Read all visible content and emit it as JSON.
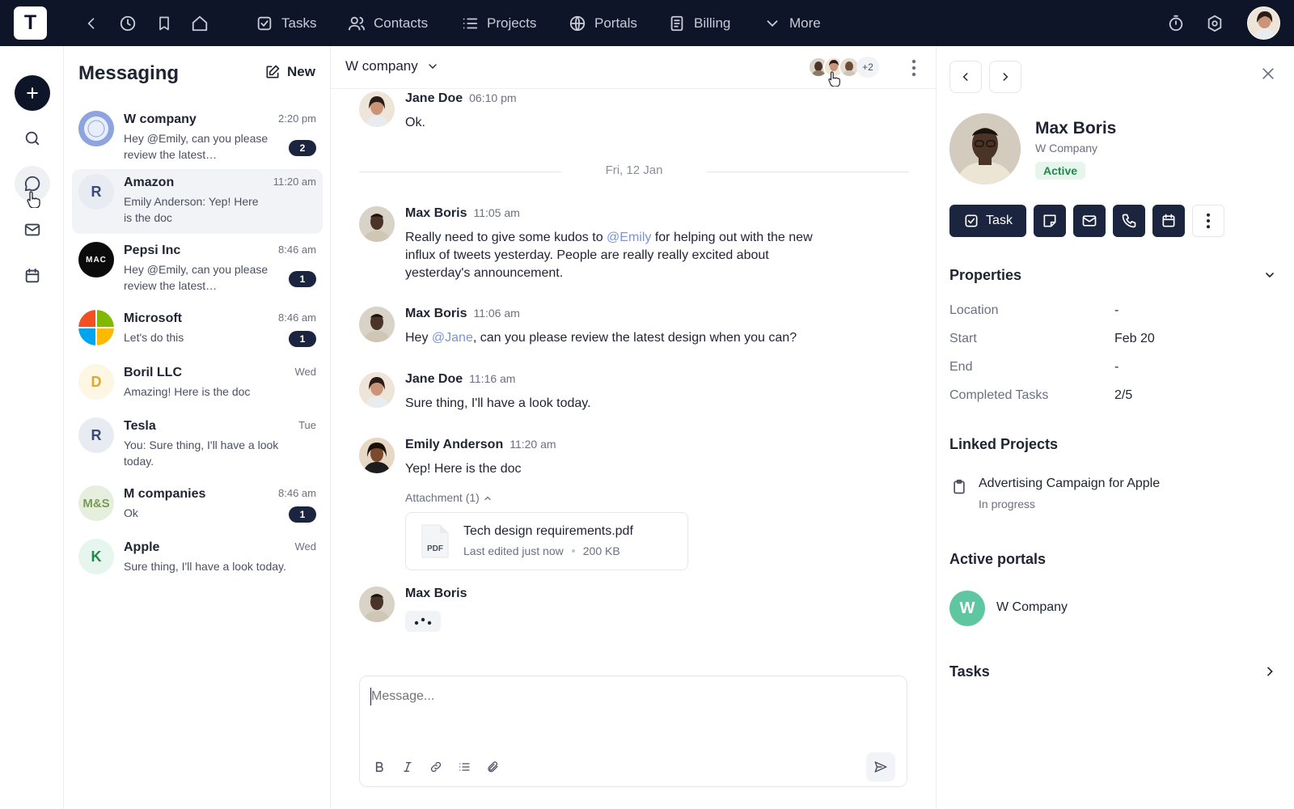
{
  "topbar": {
    "logo_letter": "T",
    "nav": [
      {
        "label": "Tasks",
        "icon": "check-square-icon"
      },
      {
        "label": "Contacts",
        "icon": "users-icon"
      },
      {
        "label": "Projects",
        "icon": "list-icon"
      },
      {
        "label": "Portals",
        "icon": "globe-icon"
      },
      {
        "label": "Billing",
        "icon": "document-icon"
      },
      {
        "label": "More",
        "icon": "chevron-down-icon"
      }
    ]
  },
  "messaging": {
    "title": "Messaging",
    "new_label": "New",
    "conversations": [
      {
        "name": "W company",
        "time": "2:20 pm",
        "preview": "Hey @Emily, can you please review the latest…",
        "badge": "2",
        "avatar": "logo"
      },
      {
        "name": "Amazon",
        "time": "11:20 am",
        "preview_prefix": "Emily Anderson:",
        "preview": "Yep! Here is the doc",
        "badge": "",
        "avatar": "R"
      },
      {
        "name": "Pepsi Inc",
        "time": "8:46 am",
        "preview": "Hey @Emily, can you please review the latest…",
        "badge": "1",
        "avatar": "MAC"
      },
      {
        "name": "Microsoft",
        "time": "8:46 am",
        "preview": "Let's do this",
        "badge": "1",
        "avatar": "ms"
      },
      {
        "name": "Boril LLC",
        "time": "Wed",
        "preview": "Amazing! Here is the doc",
        "badge": "",
        "avatar": "D"
      },
      {
        "name": "Tesla",
        "time": "Tue",
        "preview_prefix": "You:",
        "preview": "Sure thing, I'll have a look today.",
        "badge": "",
        "avatar": "R"
      },
      {
        "name": "M companies",
        "time": "8:46 am",
        "preview": "Ok",
        "badge": "1",
        "avatar": "M&S"
      },
      {
        "name": "Apple",
        "time": "Wed",
        "preview": "Sure thing, I'll have a look today.",
        "badge": "",
        "avatar": "K"
      }
    ]
  },
  "chat": {
    "title": "W company",
    "participants_more": "+2",
    "date_divider": "Fri, 12 Jan",
    "messages": [
      {
        "name": "Jane Doe",
        "time": "06:10 pm",
        "text": "Ok."
      },
      {
        "name": "Max Boris",
        "time": "11:05 am",
        "text_parts": [
          "Really need to give some kudos to ",
          "@Emily",
          " for helping out with the new influx of tweets yesterday. People are really really excited about yesterday's announcement."
        ]
      },
      {
        "name": "Max Boris",
        "time": "11:06 am",
        "text_parts": [
          "Hey ",
          "@Jane",
          ", can you please review the latest design when you can?"
        ]
      },
      {
        "name": "Jane Doe",
        "time": "11:16 am",
        "text": "Sure thing, I'll have a look today."
      },
      {
        "name": "Emily Anderson",
        "time": "11:20 am",
        "text": "Yep! Here is the doc",
        "attachment_label": "Attachment (1)",
        "file": {
          "name": "Tech design requirements.pdf",
          "edited": "Last edited just now",
          "size": "200 KB",
          "type": "PDF"
        }
      },
      {
        "name": "Max Boris",
        "time": "",
        "typing": true
      }
    ],
    "composer_placeholder": "Message..."
  },
  "panel": {
    "name": "Max Boris",
    "company": "W Company",
    "status": "Active",
    "task_label": "Task",
    "properties_title": "Properties",
    "properties": [
      {
        "label": "Location",
        "value": "-"
      },
      {
        "label": "Start",
        "value": "Feb 20"
      },
      {
        "label": "End",
        "value": "-"
      },
      {
        "label": "Completed Tasks",
        "value": "2/5"
      }
    ],
    "linked_title": "Linked Projects",
    "project_name": "Advertising Campaign for Apple",
    "project_status": "In progress",
    "portals_title": "Active portals",
    "portal_name": "W Company",
    "portal_letter": "W",
    "tasks_title": "Tasks"
  },
  "colors": {
    "navy": "#0f1528",
    "accent": "#1c2540",
    "mention": "#7a94d4",
    "active_green": "#1e8a4a"
  }
}
